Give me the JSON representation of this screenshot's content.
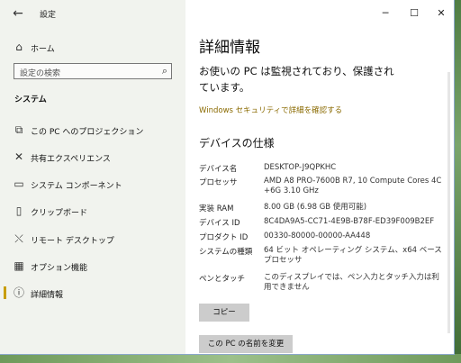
{
  "window": {
    "title": "設定",
    "back_icon": "←",
    "minimize_icon": "─",
    "maximize_icon": "☐",
    "close_icon": "✕"
  },
  "sidebar": {
    "home_label": "ホーム",
    "search_placeholder": "設定の検索",
    "section_title": "システム",
    "items": [
      {
        "label": "この PC へのプロジェクション",
        "icon": "project-icon"
      },
      {
        "label": "共有エクスペリエンス",
        "icon": "shared-icon"
      },
      {
        "label": "システム コンポーネント",
        "icon": "component-icon"
      },
      {
        "label": "クリップボード",
        "icon": "clipboard-icon"
      },
      {
        "label": "リモート デスクトップ",
        "icon": "remote-icon"
      },
      {
        "label": "オプション機能",
        "icon": "options-icon"
      },
      {
        "label": "詳細情報",
        "icon": "info-icon",
        "active": true
      }
    ]
  },
  "main": {
    "title": "詳細情報",
    "protection_line1": "お使いの PC は監視されており、保護され",
    "protection_line2": "ています。",
    "security_link": "Windows セキュリティで詳細を確認する",
    "device_specs_title": "デバイスの仕様",
    "specs": [
      {
        "key": "デバイス名",
        "value": "DESKTOP-J9QPKHC"
      },
      {
        "key": "プロセッサ",
        "value": "AMD A8 PRO-7600B R7, 10 Compute Cores 4C +6G    3.10 GHz"
      },
      {
        "key": "実装 RAM",
        "value": "8.00 GB (6.98 GB 使用可能)"
      },
      {
        "key": "デバイス ID",
        "value": "8C4DA9A5-CC71-4E9B-B78F-ED39F009B2EF"
      },
      {
        "key": "プロダクト ID",
        "value": "00330-80000-00000-AA448"
      },
      {
        "key": "システムの種類",
        "value": "64 ビット オペレーティング システム、x64 ベース プロセッサ"
      },
      {
        "key": "ペンとタッチ",
        "value": "このディスプレイでは、ペン入力とタッチ入力は利用できません"
      }
    ],
    "copy_button": "コピー",
    "rename_button": "この PC の名前を変更"
  }
}
